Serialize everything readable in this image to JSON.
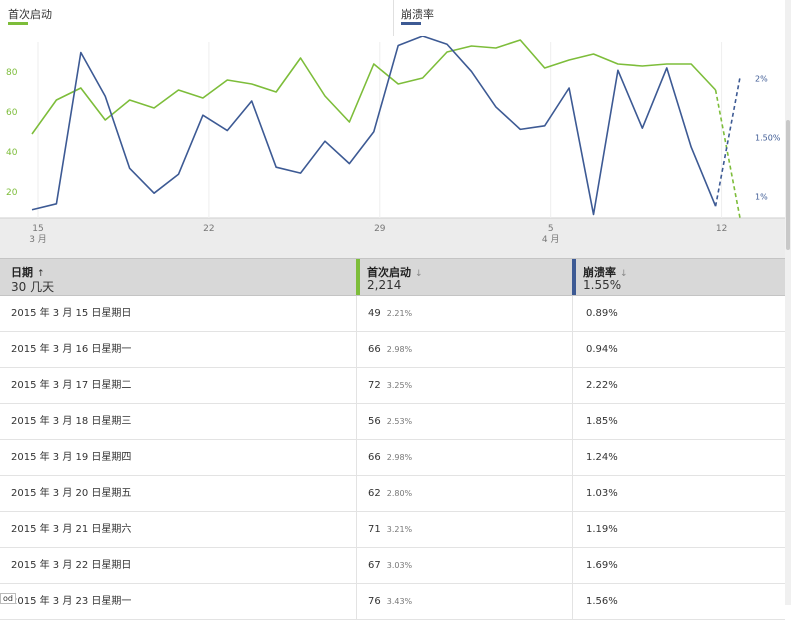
{
  "legend": [
    {
      "label": "首次启动",
      "color": "#7dbd3a"
    },
    {
      "label": "崩溃率",
      "color": "#3d5a94"
    }
  ],
  "chart_data": {
    "type": "line",
    "x": [
      "3/15",
      "3/16",
      "3/17",
      "3/18",
      "3/19",
      "3/20",
      "3/21",
      "3/22",
      "3/23",
      "3/24",
      "3/25",
      "3/26",
      "3/27",
      "3/28",
      "3/29",
      "3/30",
      "3/31",
      "4/1",
      "4/2",
      "4/3",
      "4/4",
      "4/5",
      "4/6",
      "4/7",
      "4/8",
      "4/9",
      "4/10",
      "4/11",
      "4/12",
      "4/13"
    ],
    "x_tick_labels": [
      {
        "at": "3/15",
        "day": "15",
        "month": "3 月"
      },
      {
        "at": "3/22",
        "day": "22",
        "month": ""
      },
      {
        "at": "3/29",
        "day": "29",
        "month": ""
      },
      {
        "at": "4/5",
        "day": "5",
        "month": "4 月"
      },
      {
        "at": "4/12",
        "day": "12",
        "month": ""
      }
    ],
    "left_axis": {
      "ticks": [
        20,
        40,
        60,
        80
      ],
      "range": [
        7,
        98
      ],
      "color": "#7dbd3a"
    },
    "right_axis": {
      "ticks": [
        "1%",
        "1.50%",
        "2%"
      ],
      "tick_values": [
        1.0,
        1.5,
        2.0
      ],
      "range": [
        0.82,
        2.36
      ],
      "color": "#3d5a94"
    },
    "series": [
      {
        "name": "首次启动",
        "axis": "left",
        "color": "#7dbd3a",
        "values": [
          49,
          66,
          72,
          56,
          66,
          62,
          71,
          67,
          76,
          74,
          70,
          87,
          68,
          55,
          84,
          74,
          77,
          90,
          93,
          92,
          96,
          82,
          86,
          89,
          84,
          83,
          84,
          84,
          71,
          6
        ],
        "dashed_from_index": 28
      },
      {
        "name": "崩溃率",
        "axis": "right",
        "color": "#3d5a94",
        "values": [
          0.89,
          0.94,
          2.22,
          1.85,
          1.24,
          1.03,
          1.19,
          1.69,
          1.56,
          1.81,
          1.25,
          1.2,
          1.47,
          1.28,
          1.55,
          2.28,
          2.36,
          2.29,
          2.06,
          1.76,
          1.57,
          1.6,
          1.92,
          0.85,
          2.07,
          1.58,
          2.09,
          1.42,
          0.92,
          2.01
        ],
        "dashed_from_index": 28
      }
    ]
  },
  "table": {
    "columns": [
      {
        "title": "日期",
        "sort": "↑",
        "summary": "30 几天",
        "accent": ""
      },
      {
        "title": "首次启动",
        "sort": "↓",
        "summary": "2,214",
        "accent": "#7dbd3a"
      },
      {
        "title": "崩溃率",
        "sort": "↓",
        "summary": "1.55%",
        "accent": "#3d5a94"
      }
    ],
    "rows": [
      {
        "date": "2015 年 3 月 15 日星期日",
        "launches": "49",
        "launches_pct": "2.21%",
        "crash": "0.89%"
      },
      {
        "date": "2015 年 3 月 16 日星期一",
        "launches": "66",
        "launches_pct": "2.98%",
        "crash": "0.94%"
      },
      {
        "date": "2015 年 3 月 17 日星期二",
        "launches": "72",
        "launches_pct": "3.25%",
        "crash": "2.22%"
      },
      {
        "date": "2015 年 3 月 18 日星期三",
        "launches": "56",
        "launches_pct": "2.53%",
        "crash": "1.85%"
      },
      {
        "date": "2015 年 3 月 19 日星期四",
        "launches": "66",
        "launches_pct": "2.98%",
        "crash": "1.24%"
      },
      {
        "date": "2015 年 3 月 20 日星期五",
        "launches": "62",
        "launches_pct": "2.80%",
        "crash": "1.03%"
      },
      {
        "date": "2015 年 3 月 21 日星期六",
        "launches": "71",
        "launches_pct": "3.21%",
        "crash": "1.19%"
      },
      {
        "date": "2015 年 3 月 22 日星期日",
        "launches": "67",
        "launches_pct": "3.03%",
        "crash": "1.69%"
      },
      {
        "date": "2015 年 3 月 23 日星期一",
        "launches": "76",
        "launches_pct": "3.43%",
        "crash": "1.56%"
      }
    ]
  },
  "corner_tag": "od"
}
